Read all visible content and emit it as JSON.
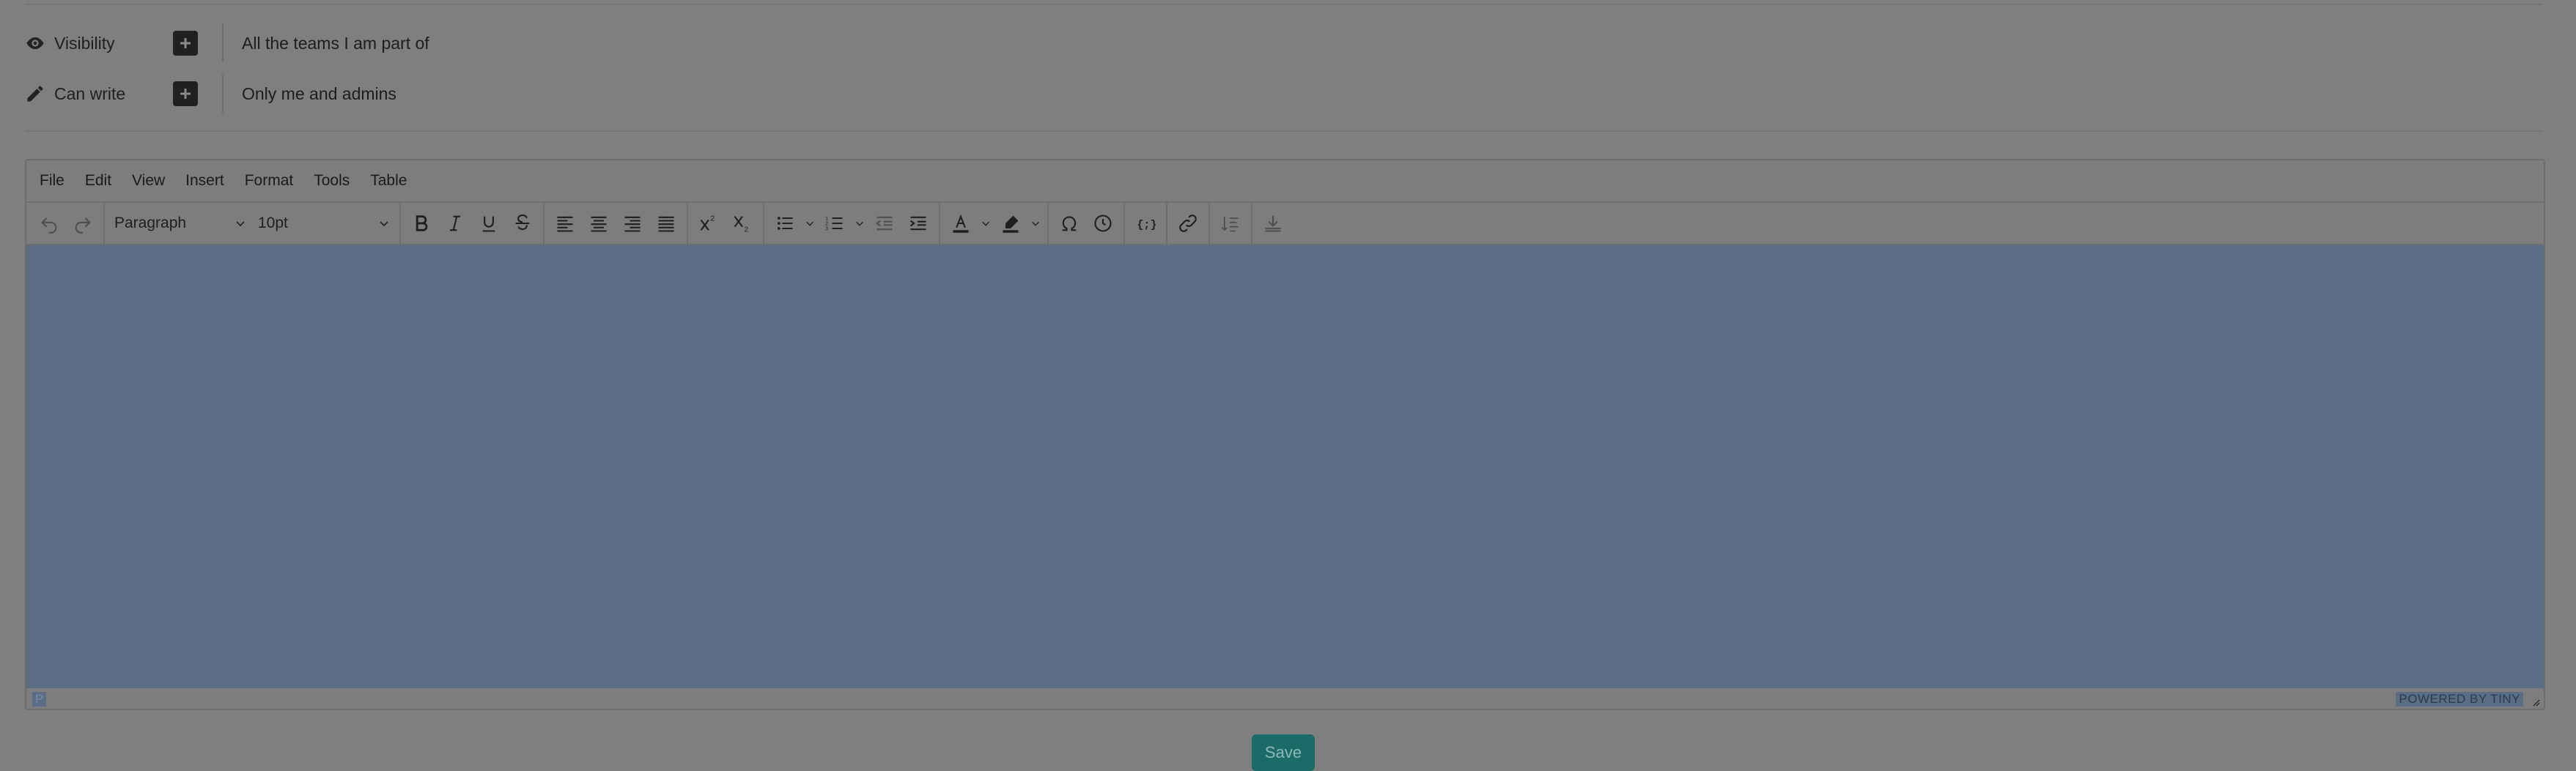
{
  "permissions": {
    "visibility": {
      "label": "Visibility",
      "value": "All the teams I am part of",
      "icon": "eye-icon"
    },
    "can_write": {
      "label": "Can write",
      "value": "Only me and admins",
      "icon": "pencil-icon"
    }
  },
  "editor": {
    "menu": [
      "File",
      "Edit",
      "View",
      "Insert",
      "Format",
      "Tools",
      "Table"
    ],
    "toolbar": {
      "block_format": "Paragraph",
      "font_size": "10pt"
    },
    "statusbar": {
      "path": "P",
      "branding": "POWERED BY TINY"
    },
    "content_highlight_color": "#5a6d85"
  },
  "actions": {
    "save_label": "Save",
    "save_color": "#1b6b69"
  }
}
